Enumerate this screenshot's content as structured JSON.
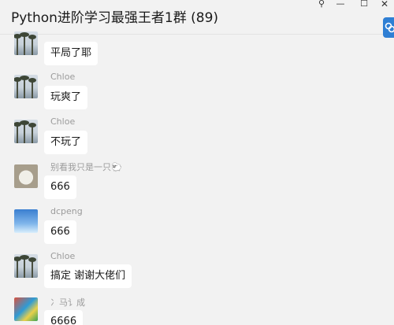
{
  "window": {
    "title": "Python进阶学习最强王者1群 (89)",
    "controls": {
      "pin": "⚲",
      "minimize": "—",
      "maximize": "☐",
      "close": "✕"
    }
  },
  "messages": [
    {
      "sender": "",
      "text": "平局了耶",
      "avatar": "tree-avatar"
    },
    {
      "sender": "Chloe",
      "text": "玩爽了",
      "avatar": "tree-avatar"
    },
    {
      "sender": "Chloe",
      "text": "不玩了",
      "avatar": "tree-avatar"
    },
    {
      "sender": "别看我只是一只🐑",
      "text": "666",
      "avatar": "cat-avatar"
    },
    {
      "sender": "dcpeng",
      "text": "666",
      "avatar": "dcpeng-avatar"
    },
    {
      "sender": "Chloe",
      "text": "搞定 谢谢大佬们",
      "avatar": "tree-avatar"
    },
    {
      "sender": "冫马讠成",
      "text": "6666",
      "avatar": "colorful-avatar"
    }
  ],
  "colors": {
    "background": "#f2f2f2",
    "bubble": "#ffffff",
    "name": "#9b9b9b",
    "accent": "#2f7fd4"
  },
  "icons": {
    "side_tab": "link-icon"
  }
}
